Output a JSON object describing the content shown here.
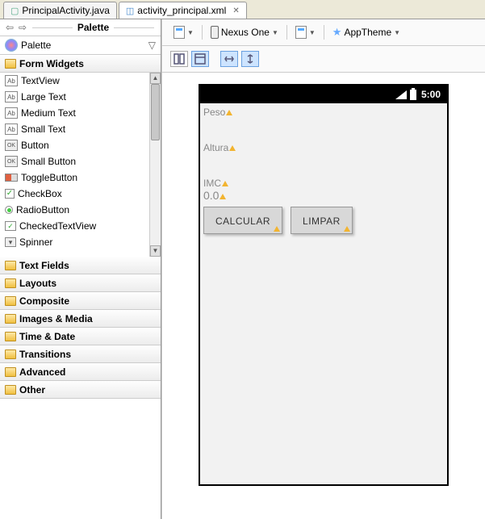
{
  "tabs": {
    "java_file": "PrincipalActivity.java",
    "xml_file": "activity_principal.xml"
  },
  "palette": {
    "nav_title": "Palette",
    "header": "Palette",
    "form_widgets": "Form Widgets",
    "items": {
      "textview": "TextView",
      "large_text": "Large Text",
      "medium_text": "Medium Text",
      "small_text": "Small Text",
      "button": "Button",
      "small_button": "Small Button",
      "toggle_button": "ToggleButton",
      "checkbox": "CheckBox",
      "radio_button": "RadioButton",
      "checked_textview": "CheckedTextView",
      "spinner": "Spinner"
    },
    "categories": {
      "text_fields": "Text Fields",
      "layouts": "Layouts",
      "composite": "Composite",
      "images_media": "Images & Media",
      "time_date": "Time & Date",
      "transitions": "Transitions",
      "advanced": "Advanced",
      "other": "Other"
    }
  },
  "toolbar": {
    "device": "Nexus One",
    "theme": "AppTheme"
  },
  "device": {
    "time": "5:00",
    "labels": {
      "peso": "Peso",
      "altura": "Altura",
      "imc": "IMC",
      "value": "0.0"
    },
    "buttons": {
      "calcular": "CALCULAR",
      "limpar": "LIMPAR"
    }
  }
}
